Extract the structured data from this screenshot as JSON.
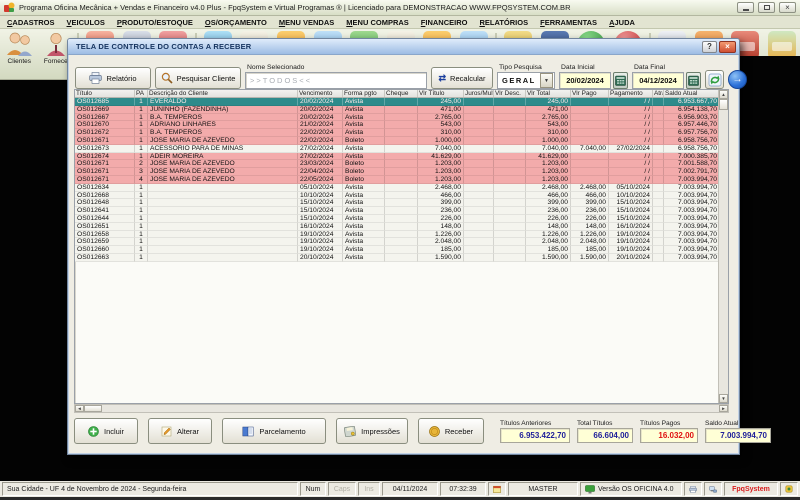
{
  "app": {
    "title": "Programa Oficina Mecânica + Vendas e Financeiro v4.0 Plus - FpqSystem e Virtual Programas ® | Licenciado para  DEMONSTRACAO WWW.FPQSYSTEM.COM.BR"
  },
  "menu": {
    "items": [
      "CADASTROS",
      "VEICULOS",
      "PRODUTO/ESTOQUE",
      "OS/ORÇAMENTO",
      "MENU VENDAS",
      "MENU COMPRAS",
      "FINANCEIRO",
      "RELATÓRIOS",
      "FERRAMENTAS",
      "AJUDA"
    ]
  },
  "toolbar": {
    "items": [
      {
        "label": "Clientes"
      },
      {
        "label": "Fornece"
      }
    ]
  },
  "icons": {
    "up": "▲",
    "down": "▼",
    "left": "◄",
    "right": "►",
    "dropdown": "▼",
    "recalculate": "⇄",
    "go": "→",
    "help": "?",
    "close": "×"
  },
  "window": {
    "title": "TELA DE CONTROLE DO CONTAS A RECEBER",
    "controls": {
      "report_button": "Relatório",
      "search_client_button": "Pesquisar Cliente",
      "selected_name_label": "Nome Selecionado",
      "selected_name_value": ">>TODOS<<",
      "recalculate_button": "Recalcular",
      "search_type_label": "Tipo  Pesquisa",
      "search_type_value": "GERAL",
      "start_date_label": "Data Inicial",
      "start_date_value": "20/02/2024",
      "end_date_label": "Data Final",
      "end_date_value": "04/12/2024"
    },
    "table": {
      "columns": [
        "Título",
        "PA",
        "Descrição do Cliente",
        "Vencimento",
        "Forma pgto",
        "Cheque",
        "Vlr Título",
        "Juros/Multa",
        "Vlr Desc.",
        "Vlr Total",
        "Vlr Pago",
        "Pagamento",
        "Atraso",
        "Saldo Atual"
      ],
      "rows": [
        {
          "state": "selected",
          "cells": [
            "OS012685",
            "1",
            "EVERALDO",
            "20/02/2024",
            "Avista",
            "",
            "245,00",
            "",
            "",
            "245,00",
            "",
            "/  /",
            "",
            "6.953.667,70"
          ]
        },
        {
          "state": "open",
          "cells": [
            "OS012669",
            "1",
            "JUNINHO (FAZENDINHA)",
            "20/02/2024",
            "Avista",
            "",
            "471,00",
            "",
            "",
            "471,00",
            "",
            "/  /",
            "",
            "6.954.138,70"
          ]
        },
        {
          "state": "open",
          "cells": [
            "OS012667",
            "1",
            "B.A. TEMPEROS",
            "20/02/2024",
            "Avista",
            "",
            "2.765,00",
            "",
            "",
            "2.765,00",
            "",
            "/  /",
            "",
            "6.956.903,70"
          ]
        },
        {
          "state": "open",
          "cells": [
            "OS012670",
            "1",
            "ADRIANO LINHARES",
            "21/02/2024",
            "Avista",
            "",
            "543,00",
            "",
            "",
            "543,00",
            "",
            "/  /",
            "",
            "6.957.446,70"
          ]
        },
        {
          "state": "open",
          "cells": [
            "OS012672",
            "1",
            "B.A. TEMPEROS",
            "22/02/2024",
            "Avista",
            "",
            "310,00",
            "",
            "",
            "310,00",
            "",
            "/  /",
            "",
            "6.957.756,70"
          ]
        },
        {
          "state": "open",
          "cells": [
            "OS012671",
            "1",
            "JOSE MARIA DE AZEVEDO",
            "22/02/2024",
            "Boleto",
            "",
            "1.000,00",
            "",
            "",
            "1.000,00",
            "",
            "/  /",
            "",
            "6.958.756,70"
          ]
        },
        {
          "state": "paid",
          "cells": [
            "OS012673",
            "1",
            "ACESSORIO PARA DE MINAS",
            "27/02/2024",
            "Avista",
            "",
            "7.040,00",
            "",
            "",
            "7.040,00",
            "7.040,00",
            "27/02/2024",
            "",
            "6.958.756,70"
          ]
        },
        {
          "state": "open",
          "cells": [
            "OS012674",
            "1",
            "ADEIR MOREIRA",
            "27/02/2024",
            "Avista",
            "",
            "41.629,00",
            "",
            "",
            "41.629,00",
            "",
            "/  /",
            "",
            "7.000.385,70"
          ]
        },
        {
          "state": "open",
          "cells": [
            "OS012671",
            "2",
            "JOSE MARIA DE AZEVEDO",
            "23/03/2024",
            "Boleto",
            "",
            "1.203,00",
            "",
            "",
            "1.203,00",
            "",
            "/  /",
            "",
            "7.001.588,70"
          ]
        },
        {
          "state": "open",
          "cells": [
            "OS012671",
            "3",
            "JOSE MARIA DE AZEVEDO",
            "22/04/2024",
            "Boleto",
            "",
            "1.203,00",
            "",
            "",
            "1.203,00",
            "",
            "/  /",
            "",
            "7.002.791,70"
          ]
        },
        {
          "state": "open",
          "cells": [
            "OS012671",
            "4",
            "JOSE MARIA DE AZEVEDO",
            "22/05/2024",
            "Boleto",
            "",
            "1.203,00",
            "",
            "",
            "1.203,00",
            "",
            "/  /",
            "",
            "7.003.994,70"
          ]
        },
        {
          "state": "paid",
          "cells": [
            "OS012634",
            "1",
            "",
            "05/10/2024",
            "Avista",
            "",
            "2.468,00",
            "",
            "",
            "2.468,00",
            "2.468,00",
            "05/10/2024",
            "",
            "7.003.994,70"
          ]
        },
        {
          "state": "paid",
          "cells": [
            "OS012668",
            "1",
            "",
            "10/10/2024",
            "Avista",
            "",
            "466,00",
            "",
            "",
            "466,00",
            "466,00",
            "10/10/2024",
            "",
            "7.003.994,70"
          ]
        },
        {
          "state": "paid",
          "cells": [
            "OS012648",
            "1",
            "",
            "15/10/2024",
            "Avista",
            "",
            "399,00",
            "",
            "",
            "399,00",
            "399,00",
            "15/10/2024",
            "",
            "7.003.994,70"
          ]
        },
        {
          "state": "paid",
          "cells": [
            "OS012641",
            "1",
            "",
            "15/10/2024",
            "Avista",
            "",
            "236,00",
            "",
            "",
            "236,00",
            "236,00",
            "15/10/2024",
            "",
            "7.003.994,70"
          ]
        },
        {
          "state": "paid",
          "cells": [
            "OS012644",
            "1",
            "",
            "15/10/2024",
            "Avista",
            "",
            "226,00",
            "",
            "",
            "226,00",
            "226,00",
            "15/10/2024",
            "",
            "7.003.994,70"
          ]
        },
        {
          "state": "paid",
          "cells": [
            "OS012651",
            "1",
            "",
            "16/10/2024",
            "Avista",
            "",
            "148,00",
            "",
            "",
            "148,00",
            "148,00",
            "16/10/2024",
            "",
            "7.003.994,70"
          ]
        },
        {
          "state": "paid",
          "cells": [
            "OS012658",
            "1",
            "",
            "19/10/2024",
            "Avista",
            "",
            "1.226,00",
            "",
            "",
            "1.226,00",
            "1.226,00",
            "19/10/2024",
            "",
            "7.003.994,70"
          ]
        },
        {
          "state": "paid",
          "cells": [
            "OS012659",
            "1",
            "",
            "19/10/2024",
            "Avista",
            "",
            "2.048,00",
            "",
            "",
            "2.048,00",
            "2.048,00",
            "19/10/2024",
            "",
            "7.003.994,70"
          ]
        },
        {
          "state": "paid",
          "cells": [
            "OS012660",
            "1",
            "",
            "19/10/2024",
            "Avista",
            "",
            "185,00",
            "",
            "",
            "185,00",
            "185,00",
            "19/10/2024",
            "",
            "7.003.994,70"
          ]
        },
        {
          "state": "paid",
          "cells": [
            "OS012663",
            "1",
            "",
            "20/10/2024",
            "Avista",
            "",
            "1.590,00",
            "",
            "",
            "1.590,00",
            "1.590,00",
            "20/10/2024",
            "",
            "7.003.994,70"
          ]
        }
      ]
    },
    "footer": {
      "include_button": "Incluir",
      "alter_button": "Alterar",
      "installment_button": "Parcelamento",
      "print_button": "Impressões",
      "receive_button": "Receber",
      "summaries": [
        {
          "label": "Títulos Anteriores",
          "value": "6.953.422,70"
        },
        {
          "label": "Total Títulos",
          "value": "66.604,00"
        },
        {
          "label": "Títulos Pagos",
          "value": "16.032,00"
        },
        {
          "label": "Saldo Atual",
          "value": "7.003.994,70"
        }
      ]
    }
  },
  "statusbar": {
    "location": "Sua Cidade - UF  4 de Novembro de 2024 - Segunda-feira",
    "num": "Num",
    "caps": "Caps",
    "ins": "Ins",
    "date": "04/11/2024",
    "time": "07:32:39",
    "user": "MASTER",
    "version": "Versão OS OFICINA 4.0",
    "brand": "FpqSystem"
  },
  "colors": {
    "selected_row": "#2e8b8b",
    "open_row": "#f3abab",
    "paid_row": "#f4f4ee",
    "field_yellow": "#ffffd6",
    "value_navy": "#20209a",
    "value_red": "#e01010",
    "window_title_blue": "#9dbce4"
  }
}
